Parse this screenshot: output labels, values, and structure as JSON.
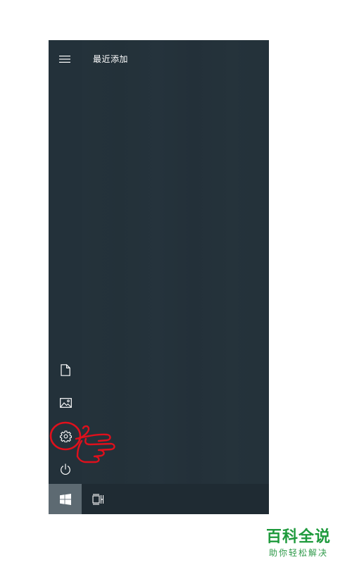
{
  "start_menu": {
    "header": {
      "menu_icon": "hamburger-menu-icon",
      "title": "最近添加"
    },
    "rail": [
      {
        "id": "documents",
        "icon": "document-icon"
      },
      {
        "id": "pictures",
        "icon": "image-icon"
      },
      {
        "id": "settings",
        "icon": "gear-icon",
        "highlighted": true
      },
      {
        "id": "power",
        "icon": "power-icon"
      }
    ],
    "taskbar": {
      "start_icon": "windows-logo-icon",
      "task_view_icon": "task-view-icon"
    },
    "colors": {
      "menu_background": "#23313a",
      "taskbar_background": "#1f2b33",
      "start_button_background": "#5d6a72",
      "icon_color": "#ffffff",
      "annotation_color": "#e0101c"
    }
  },
  "watermark": {
    "title": "百科全说",
    "subtitle": "助你轻松解决",
    "color": "#1e9a3c"
  }
}
